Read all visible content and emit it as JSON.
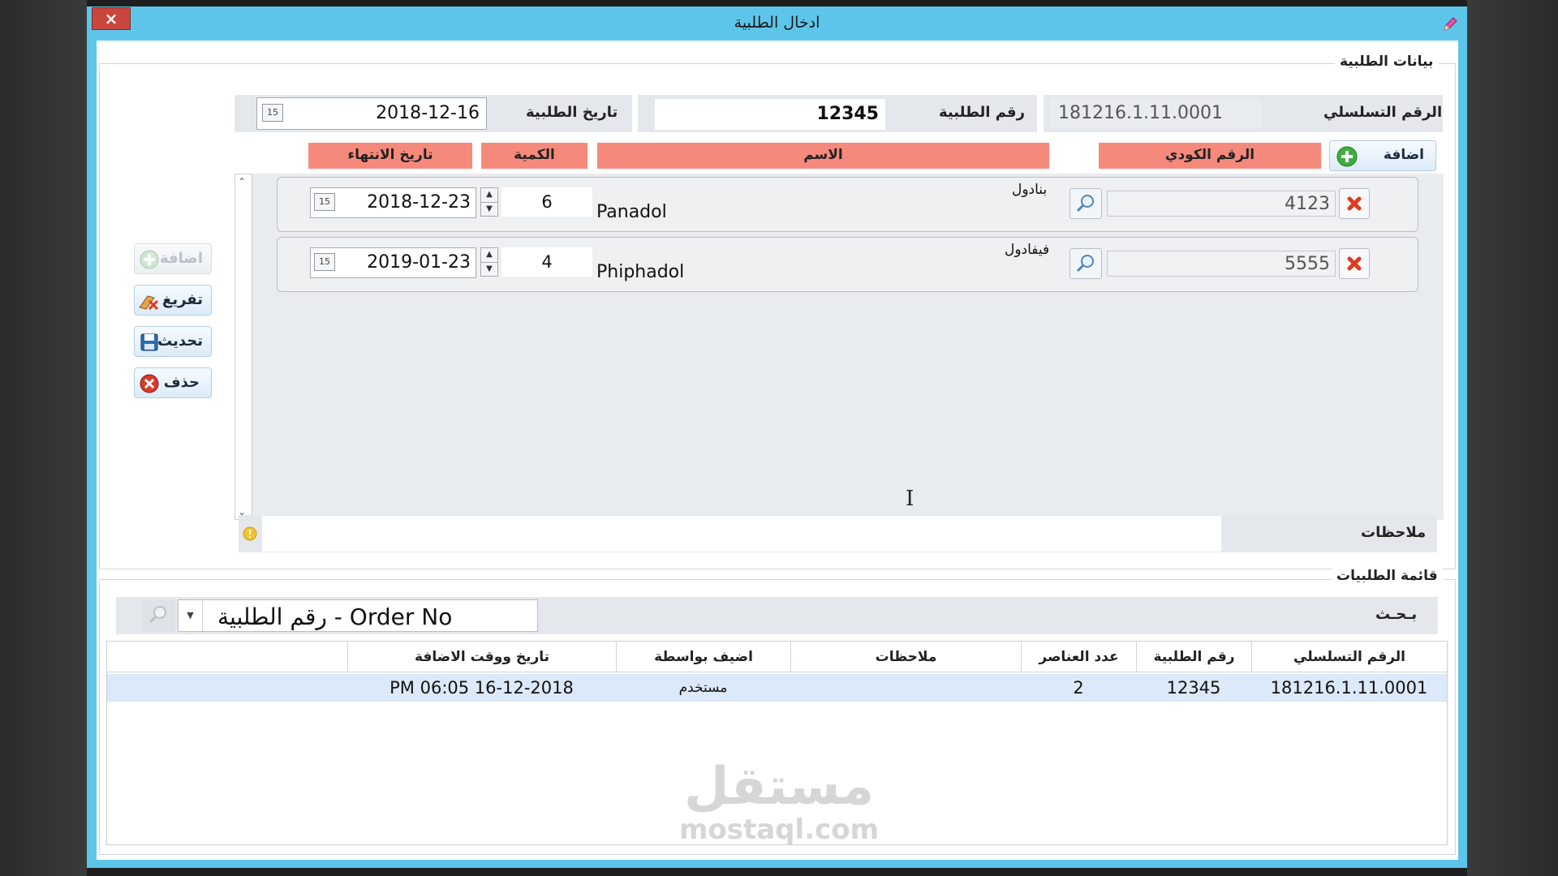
{
  "window": {
    "title": "ادخال الطلبية",
    "close_label": "×"
  },
  "order_section": {
    "title": "بيانات الطلبية",
    "serial_label": "الرقم التسلسلي",
    "serial_value": "181216.1.11.0001",
    "order_no_label": "رقم الطلبية",
    "order_no_value": "12345",
    "order_date_label": "تاريخ الطلبية",
    "order_date_value": "2018-12-16",
    "calendar_day": "15",
    "add_item_label": "اضافة",
    "headers": {
      "code": "الرقم الكودي",
      "name": "الاسم",
      "quantity": "الكمية",
      "expiry": "تاريخ الانتهاء"
    },
    "items": [
      {
        "code": "4123",
        "name_ar": "بنادول",
        "name_en": "Panadol",
        "quantity": "6",
        "expiry": "2018-12-23"
      },
      {
        "code": "5555",
        "name_ar": "فيفادول",
        "name_en": "Phiphadol",
        "quantity": "4",
        "expiry": "2019-01-23"
      }
    ],
    "notes_label": "ملاحظات",
    "notes_value": ""
  },
  "side_buttons": {
    "add": "اضافة",
    "clear": "تفريغ",
    "update": "تحديث",
    "delete": "حذف"
  },
  "list_section": {
    "title": "قائمة الطلبيات",
    "search_label": "بـحـث",
    "search_field": "رقم الطلبية - Order No",
    "columns": [
      "الرقم التسلسلي",
      "رقم الطلبية",
      "عدد العناصر",
      "ملاحظات",
      "اضيف بواسطة",
      "تاريخ ووقت الاضافة"
    ],
    "rows": [
      {
        "serial": "181216.1.11.0001",
        "order_no": "12345",
        "count": "2",
        "notes": "",
        "added_by": "مستخدم",
        "added_at": "PM 06:05 16-12-2018"
      }
    ]
  },
  "watermark": {
    "arabic": "مستقل",
    "latin": "mostaql.com"
  },
  "colors": {
    "title_bar": "#5ec5ea",
    "header_bg": "#f58a7c",
    "selected_row": "#dbe9f9",
    "close_button": "#c9463d"
  }
}
